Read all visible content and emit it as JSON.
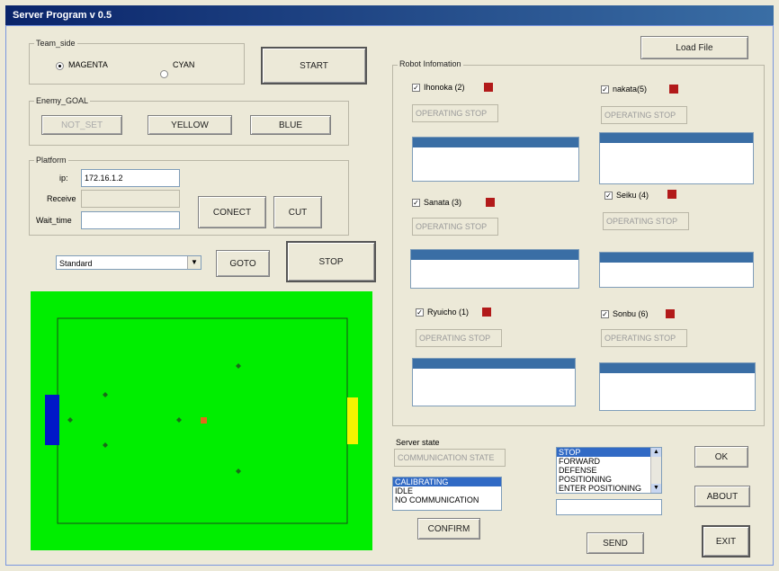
{
  "window": {
    "title": "Server Program v 0.5"
  },
  "team_side": {
    "legend": "Team_side",
    "options": [
      {
        "label": "MAGENTA",
        "selected": true
      },
      {
        "label": "CYAN",
        "selected": false
      }
    ]
  },
  "enemy_goal": {
    "legend": "Enemy_GOAL",
    "buttons": [
      "NOT_SET",
      "YELLOW",
      "BLUE"
    ]
  },
  "platform": {
    "legend": "Platform",
    "ip_label": "ip:",
    "ip_value": "172.16.1.2",
    "receive_label": "Receive",
    "receive_value": "",
    "wait_label": "Wait_time",
    "wait_value": "",
    "connect": "CONECT",
    "cut": "CUT"
  },
  "controls": {
    "start": "START",
    "stop": "STOP",
    "goto": "GOTO",
    "mode_select": "Standard"
  },
  "load_file": "Load File",
  "robot_info": {
    "legend": "Robot Infomation",
    "robots": [
      {
        "name": "Ihonoka (2)",
        "checked": true,
        "status": "OPERATING STOP"
      },
      {
        "name": "nakata(5)",
        "checked": true,
        "status": "OPERATING STOP"
      },
      {
        "name": "Sanata (3)",
        "checked": true,
        "status": "OPERATING STOP"
      },
      {
        "name": "Seiku (4)",
        "checked": true,
        "status": "OPERATING STOP"
      },
      {
        "name": "Ryuicho (1)",
        "checked": true,
        "status": "OPERATING STOP"
      },
      {
        "name": "Sonbu (6)",
        "checked": true,
        "status": "OPERATING STOP"
      }
    ]
  },
  "server_state": {
    "label": "Server state",
    "value": "COMMUNICATION STATE",
    "items": [
      "CALIBRATING",
      "IDLE",
      "NO COMMUNICATION"
    ],
    "confirm": "CONFIRM"
  },
  "command_list": {
    "items": [
      "STOP",
      "FORWARD",
      "DEFENSE",
      "POSITIONING",
      "ENTER POSITIONING"
    ],
    "send": "SEND"
  },
  "buttons": {
    "ok": "OK",
    "about": "ABOUT",
    "exit": "EXIT"
  },
  "field": {
    "colors": {
      "field": "#00ee00",
      "left_goal": "#0018c8",
      "right_goal": "#f4f400",
      "ball": "#e06a1a",
      "player": "#1a6a1a"
    }
  }
}
